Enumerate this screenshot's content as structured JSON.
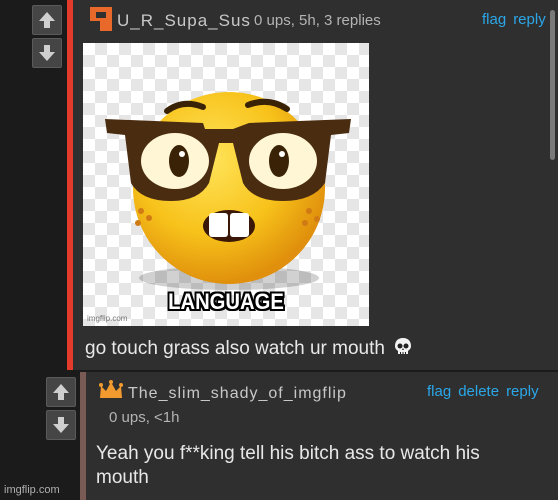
{
  "comment1": {
    "username": "U_R_Supa_Sus",
    "meta": "0 ups, 5h, 3 replies",
    "actions": [
      "flag",
      "reply"
    ],
    "image_caption": "LANGUAGE",
    "image_watermark": "imgflip.com",
    "text": "go touch grass also watch ur mouth",
    "accent_color": "#e33b2c",
    "emoji": "skull-icon"
  },
  "comment2": {
    "username": "The_slim_shady_of_imgflip",
    "meta": "0 ups, <1h",
    "actions": [
      "flag",
      "delete",
      "reply"
    ],
    "text_line1": "Yeah you f**king tell his bitch ass to watch his",
    "text_line2": "mouth",
    "accent_color": "#7a5a55"
  },
  "footer": {
    "watermark": "imgflip.com"
  },
  "colors": {
    "link": "#2ba7e8",
    "background": "#1b1b1c",
    "panel": "#2f2f30"
  }
}
